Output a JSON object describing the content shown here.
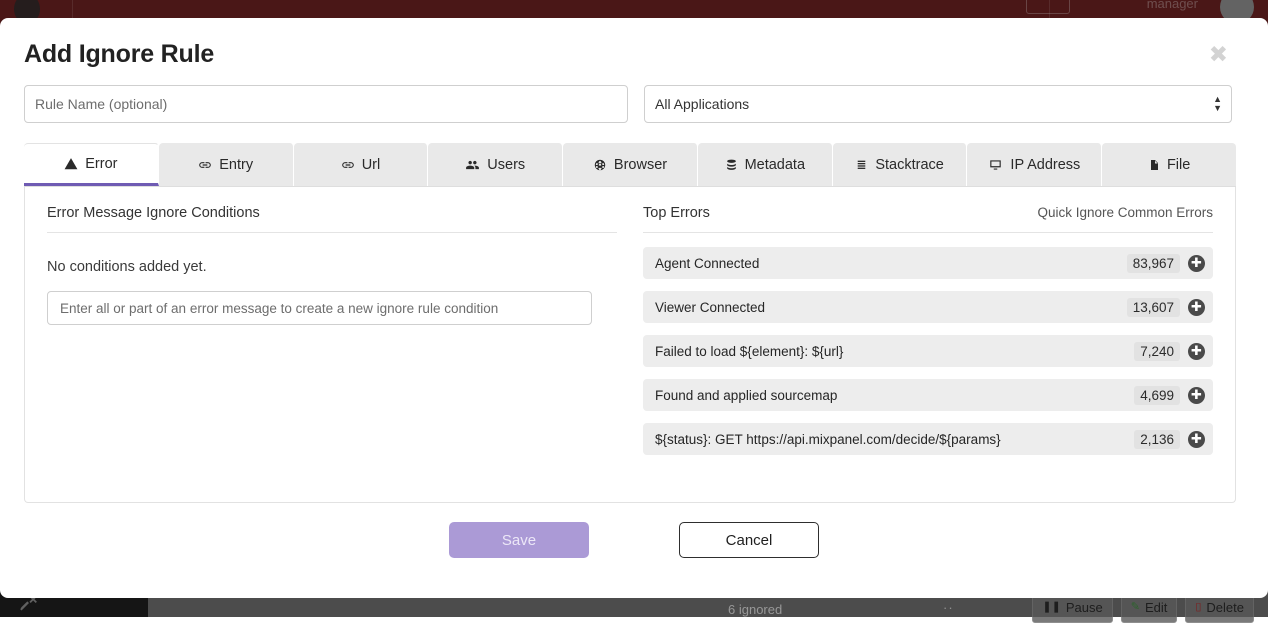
{
  "background": {
    "topbar": {
      "user_label": "manager"
    },
    "status_strip": {
      "ignored_label": "6 ignored",
      "dots_label": "··",
      "buttons": [
        {
          "label": "Pause",
          "icon": "pause-icon",
          "glyph": "❚❚"
        },
        {
          "label": "Edit",
          "icon": "pencil-icon",
          "glyph": "✎"
        },
        {
          "label": "Delete",
          "icon": "trash-icon",
          "glyph": "🗑"
        }
      ]
    }
  },
  "modal": {
    "title": "Add Ignore Rule",
    "close_label": "✖",
    "rule_name": {
      "value": "",
      "placeholder": "Rule Name (optional)"
    },
    "application_select": {
      "selected": "All Applications"
    },
    "tabs": [
      {
        "label": "Error",
        "icon": "warning-triangle-icon",
        "active": true
      },
      {
        "label": "Entry",
        "icon": "link-icon",
        "active": false
      },
      {
        "label": "Url",
        "icon": "link-icon",
        "active": false
      },
      {
        "label": "Users",
        "icon": "users-icon",
        "active": false
      },
      {
        "label": "Browser",
        "icon": "globe-icon",
        "active": false
      },
      {
        "label": "Metadata",
        "icon": "database-icon",
        "active": false
      },
      {
        "label": "Stacktrace",
        "icon": "list-icon",
        "active": false
      },
      {
        "label": "IP Address",
        "icon": "monitor-icon",
        "active": false
      },
      {
        "label": "File",
        "icon": "file-icon",
        "active": false
      }
    ],
    "conditions_panel": {
      "title": "Error Message Ignore Conditions",
      "empty_text": "No conditions added yet.",
      "input": {
        "value": "",
        "placeholder": "Enter all or part of an error message to create a new ignore rule condition"
      }
    },
    "top_errors_panel": {
      "title": "Top Errors",
      "quick_link": "Quick Ignore Common Errors",
      "add_glyph": "✚",
      "rows": [
        {
          "message": "Agent Connected",
          "count": "83,967"
        },
        {
          "message": "Viewer Connected",
          "count": "13,607"
        },
        {
          "message": "Failed to load ${element}: ${url}",
          "count": "7,240"
        },
        {
          "message": "Found and applied sourcemap",
          "count": "4,699"
        },
        {
          "message": "${status}: GET https://api.mixpanel.com/decide/${params}",
          "count": "2,136"
        }
      ]
    },
    "footer": {
      "save_label": "Save",
      "cancel_label": "Cancel"
    }
  },
  "colors": {
    "accent_purple": "#6f5bb3",
    "save_disabled": "#ab9ad6",
    "topbar_red": "#6b2222",
    "sidebar_dark": "#1f1f1f"
  }
}
